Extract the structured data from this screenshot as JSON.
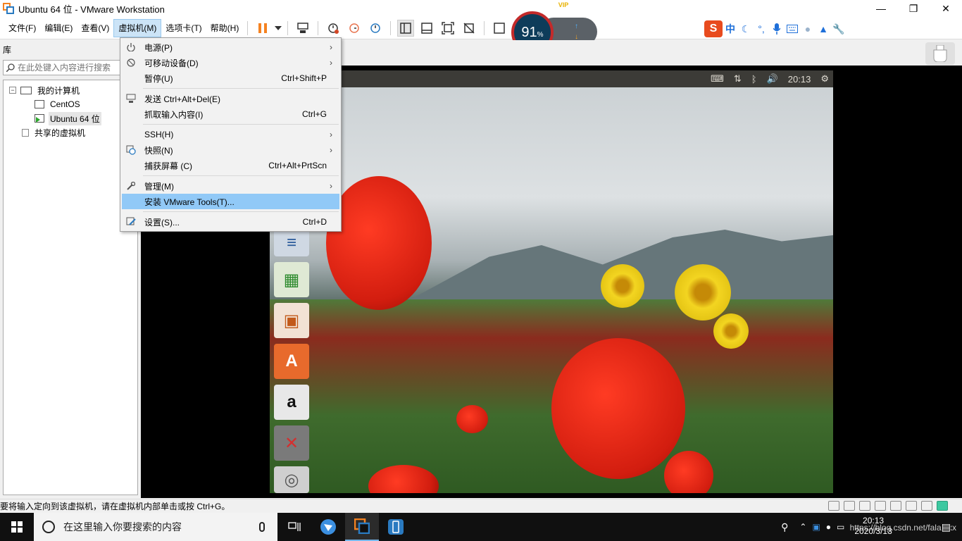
{
  "window": {
    "title": "Ubuntu 64 位 - VMware Workstation",
    "minimize": "—",
    "maximize": "❐",
    "close": "✕"
  },
  "menubar": {
    "items": [
      "文件(F)",
      "编辑(E)",
      "查看(V)",
      "虚拟机(M)",
      "选项卡(T)",
      "帮助(H)"
    ],
    "active_index": 3
  },
  "net_widget": {
    "percent": "91",
    "percent_sign": "%",
    "up_speed": "0 K/s",
    "down_speed": "0 K/s",
    "badge": "VIP"
  },
  "ime": {
    "logo": "S",
    "mode": "中",
    "icons": [
      "moon-icon",
      "punctuation-icon",
      "mic-icon",
      "keyboard-icon",
      "user-icon",
      "shirt-icon",
      "wrench-icon"
    ]
  },
  "library": {
    "header": "库",
    "search_placeholder": "在此处键入内容进行搜索",
    "tree": {
      "root": "我的计算机",
      "expander": "−",
      "children": [
        "CentOS",
        "Ubuntu 64 位"
      ],
      "selected_index": 1,
      "shared": "共享的虚拟机"
    }
  },
  "ubuntu": {
    "time": "20:13",
    "tray_icons": [
      "keyboard-icon",
      "network-icon",
      "bluetooth-icon",
      "volume-icon",
      "settings-gear-icon"
    ],
    "launcher": [
      "libreoffice-writer-icon",
      "libreoffice-calc-icon",
      "libreoffice-impress-icon",
      "ubuntu-software-icon",
      "amazon-icon",
      "system-settings-icon",
      "dvd-icon"
    ]
  },
  "vm_menu": {
    "items": [
      {
        "label": "电源(P)",
        "shortcut": "",
        "submenu": true,
        "icon": "power-icon"
      },
      {
        "label": "可移动设备(D)",
        "shortcut": "",
        "submenu": true,
        "icon": "removable-device-icon"
      },
      {
        "label": "暂停(U)",
        "shortcut": "Ctrl+Shift+P",
        "submenu": false,
        "icon": ""
      },
      {
        "label": "发送 Ctrl+Alt+Del(E)",
        "shortcut": "",
        "submenu": false,
        "icon": "send-keys-icon"
      },
      {
        "label": "抓取输入内容(I)",
        "shortcut": "Ctrl+G",
        "submenu": false,
        "icon": ""
      },
      {
        "label": "SSH(H)",
        "shortcut": "",
        "submenu": true,
        "icon": ""
      },
      {
        "label": "快照(N)",
        "shortcut": "",
        "submenu": true,
        "icon": "snapshot-icon"
      },
      {
        "label": "捕获屏幕 (C)",
        "shortcut": "Ctrl+Alt+PrtScn",
        "submenu": false,
        "icon": ""
      },
      {
        "label": "管理(M)",
        "shortcut": "",
        "submenu": true,
        "icon": "wrench-icon"
      },
      {
        "label": "安装 VMware Tools(T)...",
        "shortcut": "",
        "submenu": false,
        "icon": ""
      },
      {
        "label": "设置(S)...",
        "shortcut": "Ctrl+D",
        "submenu": false,
        "icon": "settings-icon"
      }
    ],
    "hover_index": 9,
    "submenu_arrow": "›"
  },
  "statusbar": {
    "message": "要将输入定向到该虚拟机，请在虚拟机内部单击或按 Ctrl+G。"
  },
  "taskbar": {
    "search_placeholder": "在这里输入你要搜索的内容",
    "clock_time": "20:13",
    "clock_date": "2020/3/13",
    "watermark": "https://blog.csdn.net/falalaxx"
  },
  "colors": {
    "menu_hover": "#91c9f7",
    "menu_active": "#cce4f7",
    "pause_orange": "#f58220",
    "taskbar": "#101010",
    "ubuntu_topbar": "#3c3b37"
  }
}
